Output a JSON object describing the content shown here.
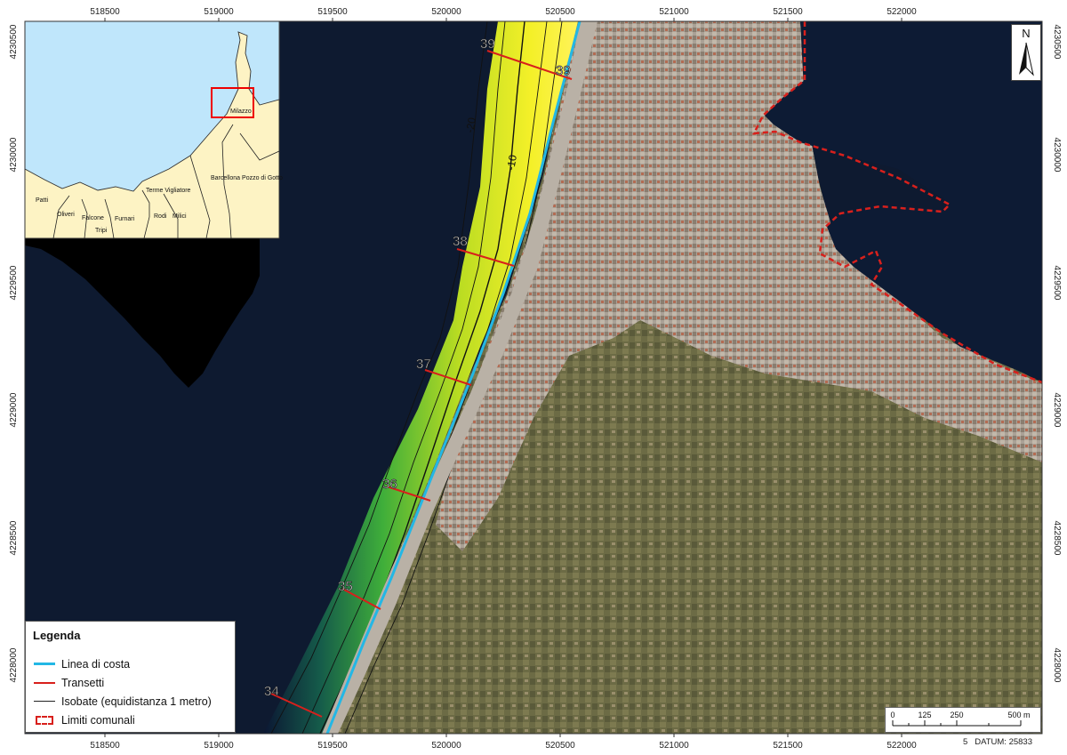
{
  "map": {
    "grid": {
      "x_labels": [
        "518500",
        "519000",
        "519500",
        "520000",
        "520500",
        "521000",
        "521500",
        "522000"
      ],
      "y_labels": [
        "4230500",
        "4230000",
        "4229500",
        "4229000",
        "4228500",
        "4228000"
      ]
    },
    "colors": {
      "sea": "#0e1a30",
      "coastline": "#23b7e5",
      "transect": "#d8201c",
      "isobath": "#111111",
      "boundary": "#d8201c",
      "inset_land": "#fdf3c4",
      "inset_sea": "#bfe6fb"
    },
    "transects": [
      {
        "id": "34",
        "label": "34"
      },
      {
        "id": "35",
        "label": "35"
      },
      {
        "id": "36",
        "label": "36"
      },
      {
        "id": "37",
        "label": "37"
      },
      {
        "id": "38",
        "label": "38"
      },
      {
        "id": "39",
        "label": "39"
      }
    ],
    "isobath_labels": [
      "-20",
      "-10"
    ]
  },
  "inset": {
    "places": [
      "Milazzo",
      "Patti",
      "Oliveri",
      "Falcone",
      "Tripi",
      "Furnari",
      "Terme Vigliatore",
      "Rodi",
      "Milici",
      "Barcellona Pozzo di Gotto"
    ]
  },
  "legend": {
    "title": "Legenda",
    "items": [
      {
        "symbol": "coastline",
        "label": "Linea di costa"
      },
      {
        "symbol": "transect",
        "label": "Transetti"
      },
      {
        "symbol": "isobath",
        "label": "Isobate (equidistanza 1 metro)"
      },
      {
        "symbol": "boundary",
        "label": "Limiti comunali"
      }
    ]
  },
  "north_arrow": {
    "label": "N",
    "icon": "north-arrow-icon"
  },
  "scalebar": {
    "ticks": [
      "0",
      "125",
      "250",
      "500 m"
    ]
  },
  "footer": {
    "page": "5",
    "datum": "DATUM: 25833"
  }
}
